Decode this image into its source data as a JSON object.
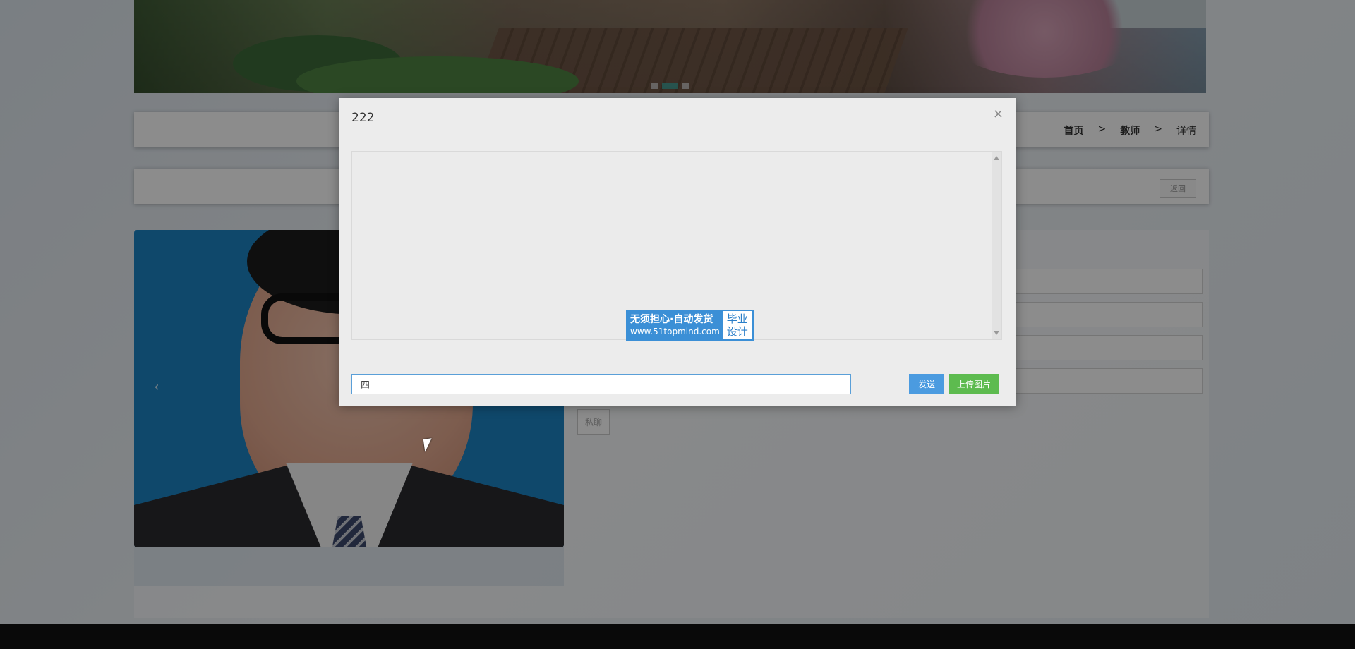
{
  "breadcrumb": {
    "home": "首页",
    "separator": ">",
    "section": "教师",
    "current": "详情"
  },
  "detail": {
    "back_label": "返回",
    "chat_label": "私聊"
  },
  "chat_modal": {
    "title": "222",
    "close_glyph": "×",
    "input_value": "四",
    "send_label": "发送",
    "upload_label": "上传图片",
    "watermark": {
      "main": "无须担心·自动发货",
      "url": "www.51topmind.com",
      "side_line1": "毕业",
      "side_line2": "设计"
    }
  },
  "colors": {
    "send_button": "#4b9be0",
    "upload_button": "#5dbb4f",
    "input_border": "#5a9fd8"
  }
}
